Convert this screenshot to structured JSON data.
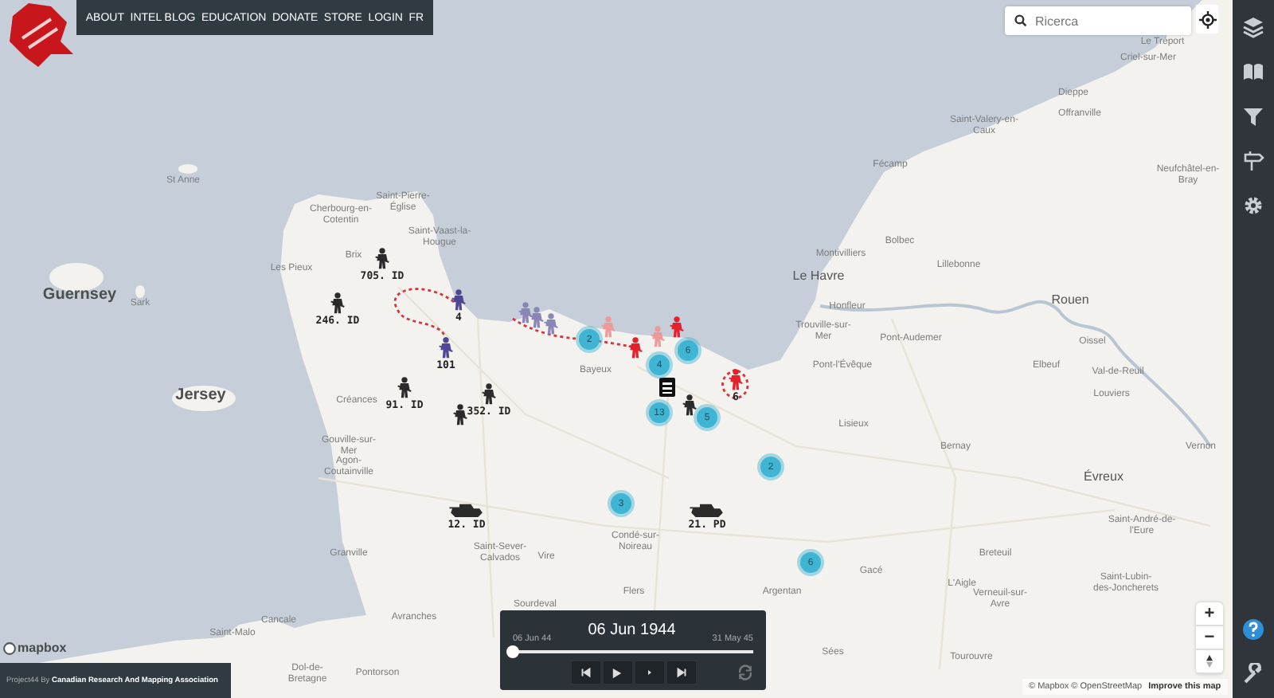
{
  "nav": {
    "items": [
      "ABOUT",
      "INTEL BLOG",
      "EDUCATION",
      "DONATE",
      "STORE",
      "LOGIN",
      "FR"
    ]
  },
  "search": {
    "placeholder": "Ricerca"
  },
  "map": {
    "places": [
      {
        "name": "Le Tréport",
        "kind": "town"
      },
      {
        "name": "Criel-sur-Mer",
        "kind": "town"
      },
      {
        "name": "Dieppe",
        "kind": "town"
      },
      {
        "name": "Saint-Valery-en-Caux",
        "kind": "town"
      },
      {
        "name": "Offranville",
        "kind": "town"
      },
      {
        "name": "Fécamp",
        "kind": "town"
      },
      {
        "name": "St Anne",
        "kind": "town"
      },
      {
        "name": "Neufchâtel-en-Bray",
        "kind": "town"
      },
      {
        "name": "Cherbourg-en-Cotentin",
        "kind": "town"
      },
      {
        "name": "Saint-Pierre-Église",
        "kind": "town"
      },
      {
        "name": "Saint-Vaast-la-Hougue",
        "kind": "town"
      },
      {
        "name": "Bolbec",
        "kind": "town"
      },
      {
        "name": "Brix",
        "kind": "town"
      },
      {
        "name": "Montivilliers",
        "kind": "town"
      },
      {
        "name": "Les Pieux",
        "kind": "town"
      },
      {
        "name": "Le Havre",
        "kind": "city"
      },
      {
        "name": "Lillebonne",
        "kind": "town"
      },
      {
        "name": "Guernsey",
        "kind": "island"
      },
      {
        "name": "Sark",
        "kind": "town"
      },
      {
        "name": "Honfleur",
        "kind": "town"
      },
      {
        "name": "Rouen",
        "kind": "city"
      },
      {
        "name": "Trouville-sur-Mer",
        "kind": "town"
      },
      {
        "name": "Pont-Audemer",
        "kind": "town"
      },
      {
        "name": "Oissel",
        "kind": "town"
      },
      {
        "name": "Bayeux",
        "kind": "town"
      },
      {
        "name": "Pont-l'Évêque",
        "kind": "town"
      },
      {
        "name": "Elbeuf",
        "kind": "town"
      },
      {
        "name": "Val-de-Reuil",
        "kind": "town"
      },
      {
        "name": "Jersey",
        "kind": "island"
      },
      {
        "name": "Créances",
        "kind": "town"
      },
      {
        "name": "Louviers",
        "kind": "town"
      },
      {
        "name": "Lisieux",
        "kind": "town"
      },
      {
        "name": "Gouville-sur-Mer",
        "kind": "town"
      },
      {
        "name": "Bernay",
        "kind": "town"
      },
      {
        "name": "Vernon",
        "kind": "town"
      },
      {
        "name": "Agon-Coutainville",
        "kind": "town"
      },
      {
        "name": "Évreux",
        "kind": "city"
      },
      {
        "name": "Granville",
        "kind": "town"
      },
      {
        "name": "Saint-Sever-Calvados",
        "kind": "town"
      },
      {
        "name": "Vire",
        "kind": "town"
      },
      {
        "name": "Condé-sur-Noireau",
        "kind": "town"
      },
      {
        "name": "Saint-André-de-l'Eure",
        "kind": "town"
      },
      {
        "name": "Breteuil",
        "kind": "town"
      },
      {
        "name": "Gacé",
        "kind": "town"
      },
      {
        "name": "Flers",
        "kind": "town"
      },
      {
        "name": "Argentan",
        "kind": "town"
      },
      {
        "name": "L'Aigle",
        "kind": "town"
      },
      {
        "name": "Sourdeval",
        "kind": "town"
      },
      {
        "name": "Verneuil-sur-Avre",
        "kind": "town"
      },
      {
        "name": "Saint-Lubin-des-Joncherets",
        "kind": "town"
      },
      {
        "name": "Cancale",
        "kind": "town"
      },
      {
        "name": "Avranches",
        "kind": "town"
      },
      {
        "name": "Saint-Malo",
        "kind": "town"
      },
      {
        "name": "Sées",
        "kind": "town"
      },
      {
        "name": "Tourouvre",
        "kind": "town"
      },
      {
        "name": "Dol-de-Bretagne",
        "kind": "town"
      },
      {
        "name": "Pontorson",
        "kind": "town"
      }
    ],
    "units": [
      {
        "kind": "infantry",
        "color": "#2b2b2b",
        "label": "705. ID"
      },
      {
        "kind": "infantry",
        "color": "#2b2b2b",
        "label": "246. ID"
      },
      {
        "kind": "infantry",
        "color": "#4f4796",
        "label": "4"
      },
      {
        "kind": "infantry",
        "color": "#4f4796",
        "label": "101"
      },
      {
        "kind": "infantry",
        "color": "#2b2b2b",
        "label": "91. ID"
      },
      {
        "kind": "infantry",
        "color": "#2b2b2b",
        "label": "352. ID"
      },
      {
        "kind": "infantry",
        "color": "#2b2b2b"
      },
      {
        "kind": "tank",
        "color": "#2b2b2b",
        "label": "12. ID"
      },
      {
        "kind": "tank",
        "color": "#2b2b2b",
        "label": "21. PD"
      },
      {
        "kind": "infantry",
        "color": "#8a86b8"
      },
      {
        "kind": "infantry",
        "color": "#8a86b8"
      },
      {
        "kind": "infantry",
        "color": "#8a86b8"
      },
      {
        "kind": "infantry",
        "color": "#ec9a9a"
      },
      {
        "kind": "infantry",
        "color": "#ec9a9a"
      },
      {
        "kind": "infantry",
        "color": "#e3222e"
      },
      {
        "kind": "infantry",
        "color": "#e3222e"
      },
      {
        "kind": "infantry",
        "color": "#e3222e",
        "label": "6"
      },
      {
        "kind": "infantry",
        "color": "#2b2b2b"
      },
      {
        "kind": "hq",
        "color": "#111111"
      }
    ],
    "clusters": [
      {
        "count": "2"
      },
      {
        "count": "4"
      },
      {
        "count": "6"
      },
      {
        "count": "13"
      },
      {
        "count": "5"
      },
      {
        "count": "2"
      },
      {
        "count": "3"
      },
      {
        "count": "6"
      }
    ]
  },
  "zoom": {
    "in": "+",
    "out": "−"
  },
  "mapbox_logo": "mapbox",
  "timeline": {
    "date": "06 Jun 1944",
    "start": "06 Jun 44",
    "end": "31 May 45",
    "level": 0
  },
  "attribution": {
    "text": "© Mapbox © OpenStreetMap",
    "link": "Improve this map"
  },
  "footer": "Project44 By **Canadian Research And Mapping Association**"
}
